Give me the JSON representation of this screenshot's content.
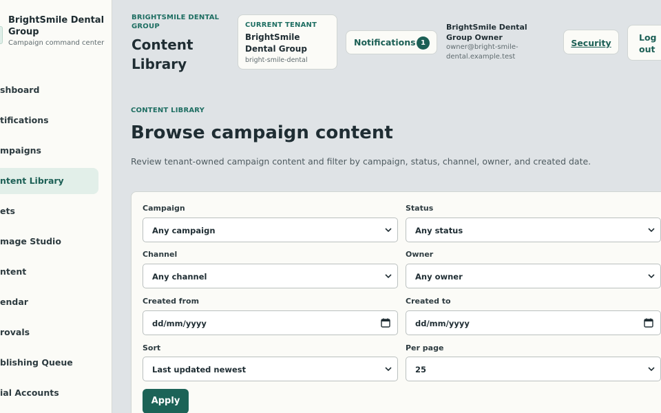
{
  "colors": {
    "accent": "#1c5f55",
    "active_bg": "#e2efe9",
    "page_bg": "#dfe3e6",
    "card_bg": "#fbfbf7"
  },
  "sidebar": {
    "brand_name": "BrightSmile Dental Group",
    "brand_sub": "Campaign command center",
    "items": [
      {
        "label": "Dashboard",
        "visible_text": "shboard"
      },
      {
        "label": "Notifications",
        "visible_text": "tifications"
      },
      {
        "label": "Campaigns",
        "visible_text": "mpaigns"
      },
      {
        "label": "Content Library",
        "visible_text": "ntent Library",
        "active": true
      },
      {
        "label": "Assets",
        "visible_text": "ets"
      },
      {
        "label": "AI Image Studio",
        "visible_text": "mage Studio"
      },
      {
        "label": "Content",
        "visible_text": "ntent"
      },
      {
        "label": "Calendar",
        "visible_text": "endar"
      },
      {
        "label": "Approvals",
        "visible_text": "rovals"
      },
      {
        "label": "Publishing Queue",
        "visible_text": "blishing Queue"
      },
      {
        "label": "Social Accounts",
        "visible_text": "ial Accounts"
      }
    ]
  },
  "header": {
    "org_eyebrow": "BRIGHTSMILE DENTAL GROUP",
    "title": "Content Library",
    "tenant": {
      "eyebrow": "CURRENT TENANT",
      "name": "BrightSmile Dental Group",
      "slug": "bright-smile-dental"
    },
    "notifications": {
      "label": "Notifications",
      "count": "1"
    },
    "user": {
      "name": "BrightSmile Dental Group Owner",
      "email": "owner@bright-smile-dental.example.test"
    },
    "security_label": "Security",
    "logout_label": "Log out"
  },
  "main": {
    "eyebrow": "CONTENT LIBRARY",
    "title": "Browse campaign content",
    "description": "Review tenant-owned campaign content and filter by campaign, status, channel, owner, and created date."
  },
  "filters": {
    "campaign": {
      "label": "Campaign",
      "value": "Any campaign"
    },
    "status": {
      "label": "Status",
      "value": "Any status"
    },
    "channel": {
      "label": "Channel",
      "value": "Any channel"
    },
    "owner": {
      "label": "Owner",
      "value": "Any owner"
    },
    "created_from": {
      "label": "Created from",
      "placeholder": "dd/mm/yyyy"
    },
    "created_to": {
      "label": "Created to",
      "placeholder": "dd/mm/yyyy"
    },
    "sort": {
      "label": "Sort",
      "value": "Last updated newest"
    },
    "per_page": {
      "label": "Per page",
      "value": "25"
    },
    "apply_label": "Apply"
  },
  "icons": {
    "select": "chevron-down-icon",
    "date": "calendar-icon"
  }
}
